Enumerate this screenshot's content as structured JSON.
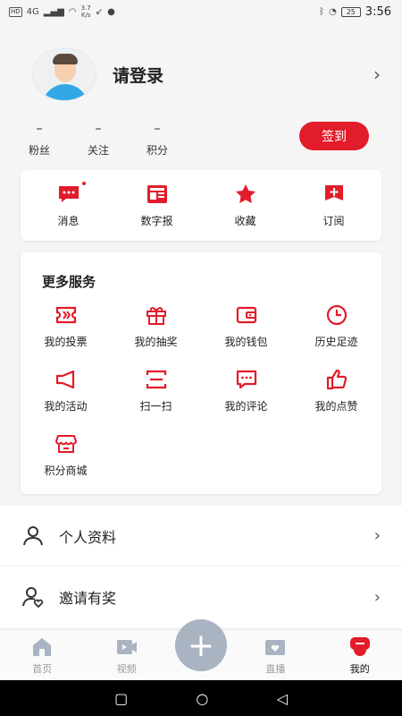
{
  "status_bar": {
    "left_badges": [
      "HD",
      "4G"
    ],
    "speed_value": "3.7",
    "speed_unit": "K/s",
    "battery": "25",
    "time": "3:56"
  },
  "profile": {
    "login_label": "请登录"
  },
  "stats": [
    {
      "value": "–",
      "label": "粉丝"
    },
    {
      "value": "–",
      "label": "关注"
    },
    {
      "value": "–",
      "label": "积分"
    }
  ],
  "signin_label": "签到",
  "quick_actions": [
    {
      "label": "消息",
      "icon": "message-icon",
      "has_dot": true
    },
    {
      "label": "数字报",
      "icon": "newspaper-icon"
    },
    {
      "label": "收藏",
      "icon": "star-icon"
    },
    {
      "label": "订阅",
      "icon": "subscribe-icon"
    }
  ],
  "services": {
    "title": "更多服务",
    "items": [
      {
        "label": "我的投票",
        "icon": "ticket-icon"
      },
      {
        "label": "我的抽奖",
        "icon": "gift-icon"
      },
      {
        "label": "我的钱包",
        "icon": "wallet-icon"
      },
      {
        "label": "历史足迹",
        "icon": "clock-icon"
      },
      {
        "label": "我的活动",
        "icon": "megaphone-icon"
      },
      {
        "label": "扫一扫",
        "icon": "scan-icon"
      },
      {
        "label": "我的评论",
        "icon": "comment-icon"
      },
      {
        "label": "我的点赞",
        "icon": "thumbs-up-icon"
      },
      {
        "label": "积分商城",
        "icon": "store-icon"
      }
    ]
  },
  "list": [
    {
      "label": "个人资料",
      "icon": "person-icon"
    },
    {
      "label": "邀请有奖",
      "icon": "invite-icon"
    }
  ],
  "bottom_nav": {
    "items": [
      {
        "label": "首页",
        "icon": "home-icon"
      },
      {
        "label": "视频",
        "icon": "video-icon"
      },
      {
        "label": "直播",
        "icon": "live-icon"
      },
      {
        "label": "我的",
        "icon": "mine-icon",
        "active": true
      }
    ],
    "plus": "+"
  },
  "colors": {
    "accent": "#e21c2a",
    "plus_button": "#a9b3c1"
  }
}
